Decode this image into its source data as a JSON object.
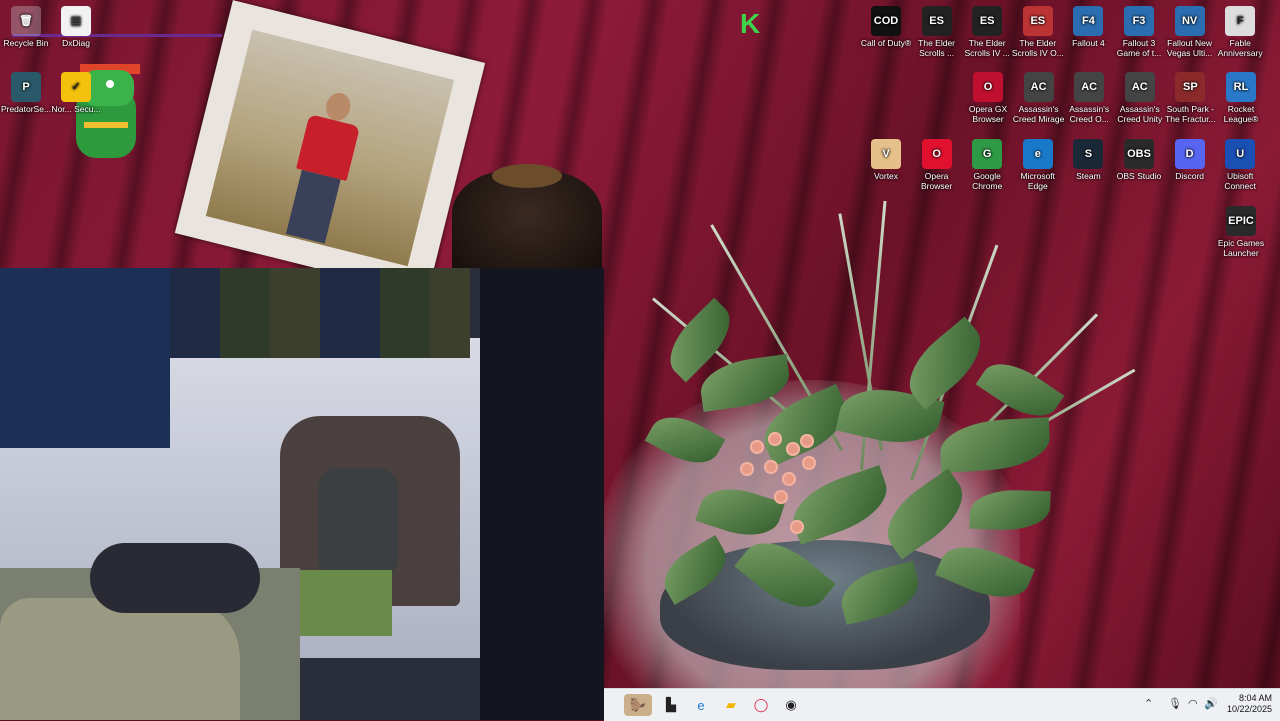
{
  "overlay": {
    "k_logo": "K",
    "top_text_left": "",
    "top_text_right": ""
  },
  "desktop": {
    "left_icons": [
      {
        "label": "Recycle Bin",
        "icon": "recycle-bin-icon"
      },
      {
        "label": "DxDiag",
        "icon": "file-icon"
      },
      {
        "label": "PredatorSe...",
        "icon": "predator-icon"
      },
      {
        "label": "Nor... Secu...",
        "icon": "norton-icon"
      }
    ],
    "right_icons_row1": [
      {
        "label": "Call of Duty®",
        "icon": "cod-icon",
        "abbr": "COD"
      },
      {
        "label": "The Elder Scrolls ...",
        "icon": "elder-scrolls-icon",
        "abbr": "ES"
      },
      {
        "label": "The Elder Scrolls IV ...",
        "icon": "elder-scrolls-icon",
        "abbr": "ES"
      },
      {
        "label": "The Elder Scrolls IV O...",
        "icon": "oblivion-icon",
        "abbr": "ES"
      },
      {
        "label": "Fallout 4",
        "icon": "fallout-icon",
        "abbr": "F4"
      },
      {
        "label": "Fallout 3 Game of t...",
        "icon": "fallout-icon",
        "abbr": "F3"
      },
      {
        "label": "Fallout New Vegas Ulti...",
        "icon": "fallout-icon",
        "abbr": "NV"
      },
      {
        "label": "Fable Anniversary",
        "icon": "fable-icon",
        "abbr": "F"
      }
    ],
    "right_icons_row2": [
      {
        "label": "Opera GX Browser",
        "icon": "opera-gx-icon",
        "abbr": "O"
      },
      {
        "label": "Assassin's Creed Mirage",
        "icon": "assassins-creed-icon",
        "abbr": "AC"
      },
      {
        "label": "Assassin's Creed O...",
        "icon": "assassins-creed-icon",
        "abbr": "AC"
      },
      {
        "label": "Assassin's Creed Unity",
        "icon": "assassins-creed-icon",
        "abbr": "AC"
      },
      {
        "label": "South Park - The Fractur...",
        "icon": "south-park-icon",
        "abbr": "SP"
      },
      {
        "label": "Rocket League®",
        "icon": "rocket-league-icon",
        "abbr": "RL"
      }
    ],
    "right_icons_row3": [
      {
        "label": "Vortex",
        "icon": "vortex-icon",
        "abbr": "V"
      },
      {
        "label": "Opera Browser",
        "icon": "opera-icon",
        "abbr": "O"
      },
      {
        "label": "Google Chrome",
        "icon": "chrome-icon",
        "abbr": "G"
      },
      {
        "label": "Microsoft Edge",
        "icon": "edge-icon",
        "abbr": "e"
      },
      {
        "label": "Steam",
        "icon": "steam-icon",
        "abbr": "S"
      },
      {
        "label": "OBS Studio",
        "icon": "obs-icon",
        "abbr": "OBS"
      },
      {
        "label": "Discord",
        "icon": "discord-icon",
        "abbr": "D"
      },
      {
        "label": "Ubisoft Connect",
        "icon": "ubisoft-icon",
        "abbr": "U"
      }
    ],
    "right_icons_row4": [
      {
        "label": "Epic Games Launcher",
        "icon": "epic-games-icon",
        "abbr": "EPIC"
      }
    ]
  },
  "taskbar": {
    "clock_time": "8:04 AM",
    "clock_date": "10/22/2025"
  },
  "colors": {
    "accent_green": "#3fd34a",
    "taskbar_bg": "#eef0f4",
    "wallpaper": "#7a1630"
  }
}
